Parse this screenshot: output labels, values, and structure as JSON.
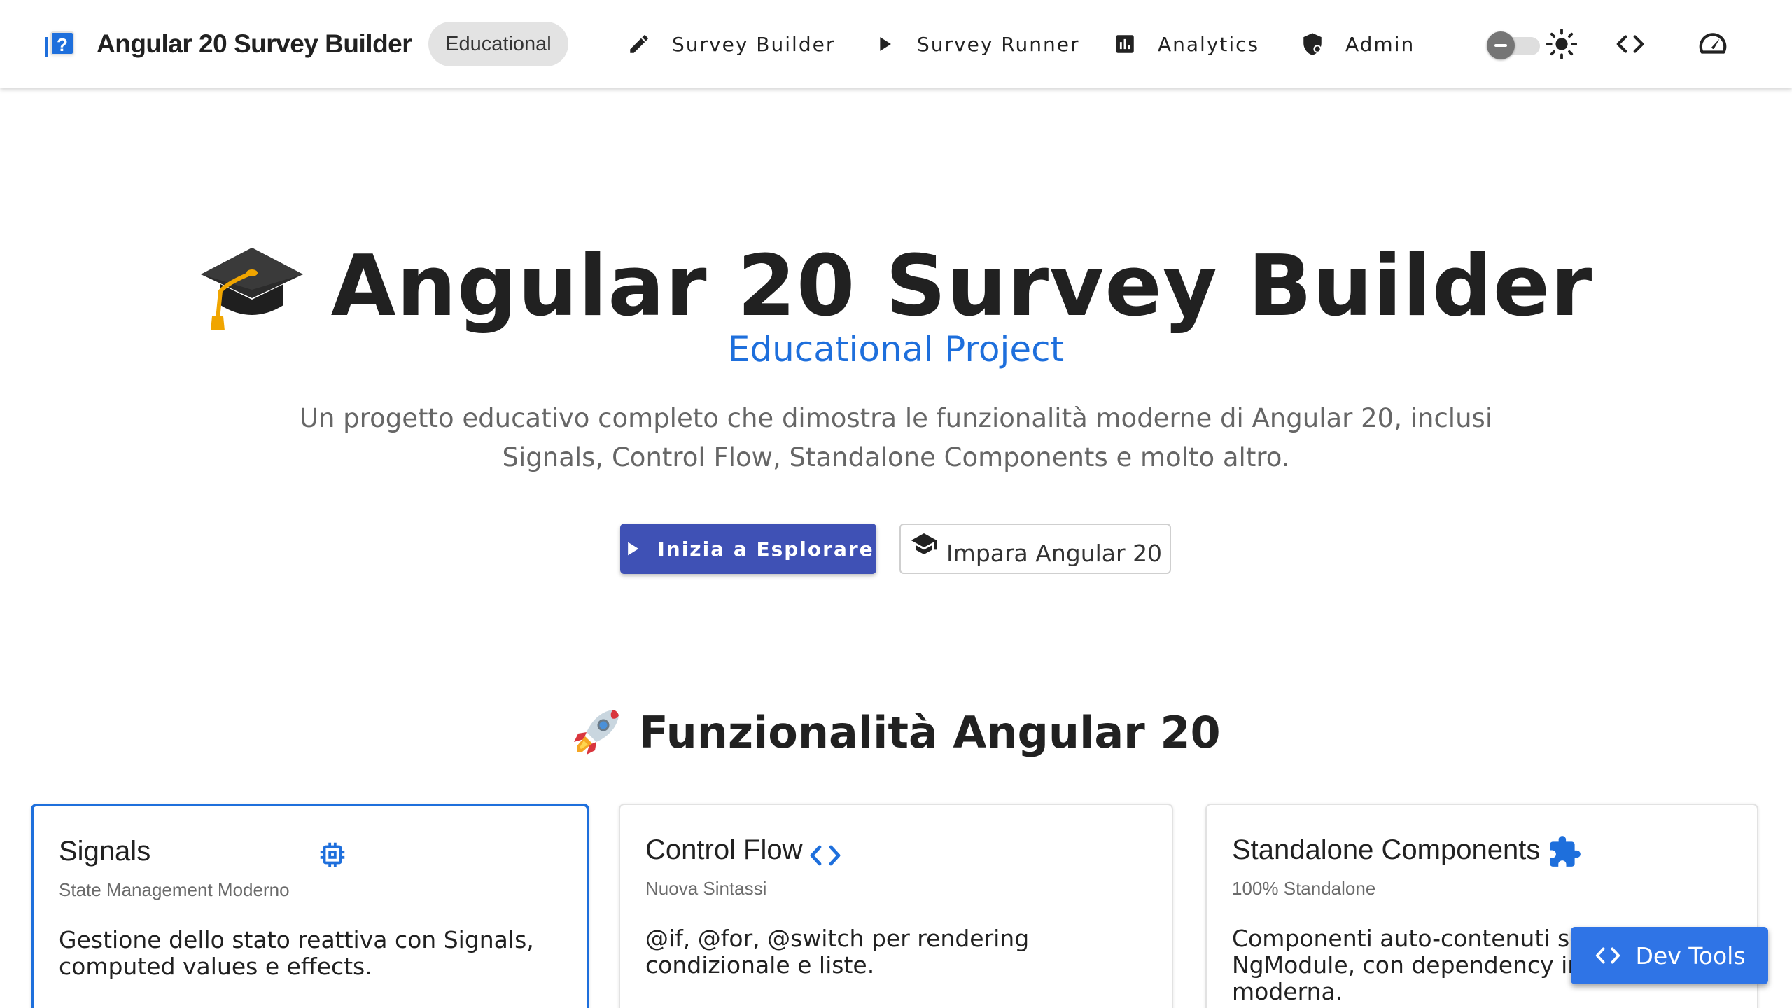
{
  "app": {
    "brand_title": "Angular 20 Survey Builder",
    "brand_chip": "Educational",
    "brand_icon": "quiz-icon"
  },
  "nav": [
    {
      "label": "Survey Builder",
      "icon": "edit-icon"
    },
    {
      "label": "Survey Runner",
      "icon": "play-icon"
    },
    {
      "label": "Analytics",
      "icon": "analytics-icon"
    },
    {
      "label": "Admin",
      "icon": "admin-shield-icon"
    }
  ],
  "toolbar_right": {
    "theme_toggle_state": "off",
    "icons": [
      "light-mode-icon",
      "code-icon",
      "speed-icon"
    ]
  },
  "hero": {
    "title": "Angular 20 Survey Builder",
    "title_emoji": "graduation-cap-emoji",
    "subtitle": "Educational Project",
    "description": "Un progetto educativo completo che dimostra le funzionalità moderne di Angular 20, inclusi Signals, Control Flow, Standalone Components e molto altro.",
    "primary_button": "Inizia a Esplorare",
    "secondary_button": "Impara Angular 20"
  },
  "features": {
    "title": "Funzionalità Angular 20",
    "title_emoji": "rocket-emoji",
    "cards": [
      {
        "title": "Signals",
        "subtitle": "State Management Moderno",
        "body": "Gestione dello stato reattiva con Signals, computed values e effects.",
        "icon": "memory-chip-icon"
      },
      {
        "title": "Control Flow",
        "subtitle": "Nuova Sintassi",
        "body": "@if, @for, @switch per rendering condizionale e liste.",
        "icon": "code-icon"
      },
      {
        "title": "Standalone Components",
        "subtitle": "100% Standalone",
        "body": "Componenti auto-contenuti senza NgModule, con dependency injection moderna.",
        "icon": "extension-icon"
      }
    ]
  },
  "devtools": {
    "label": "Dev Tools"
  },
  "colors": {
    "accent": "#1e6fdc",
    "primary_button": "#3f51b5",
    "devtools_button": "#2f74e6"
  }
}
